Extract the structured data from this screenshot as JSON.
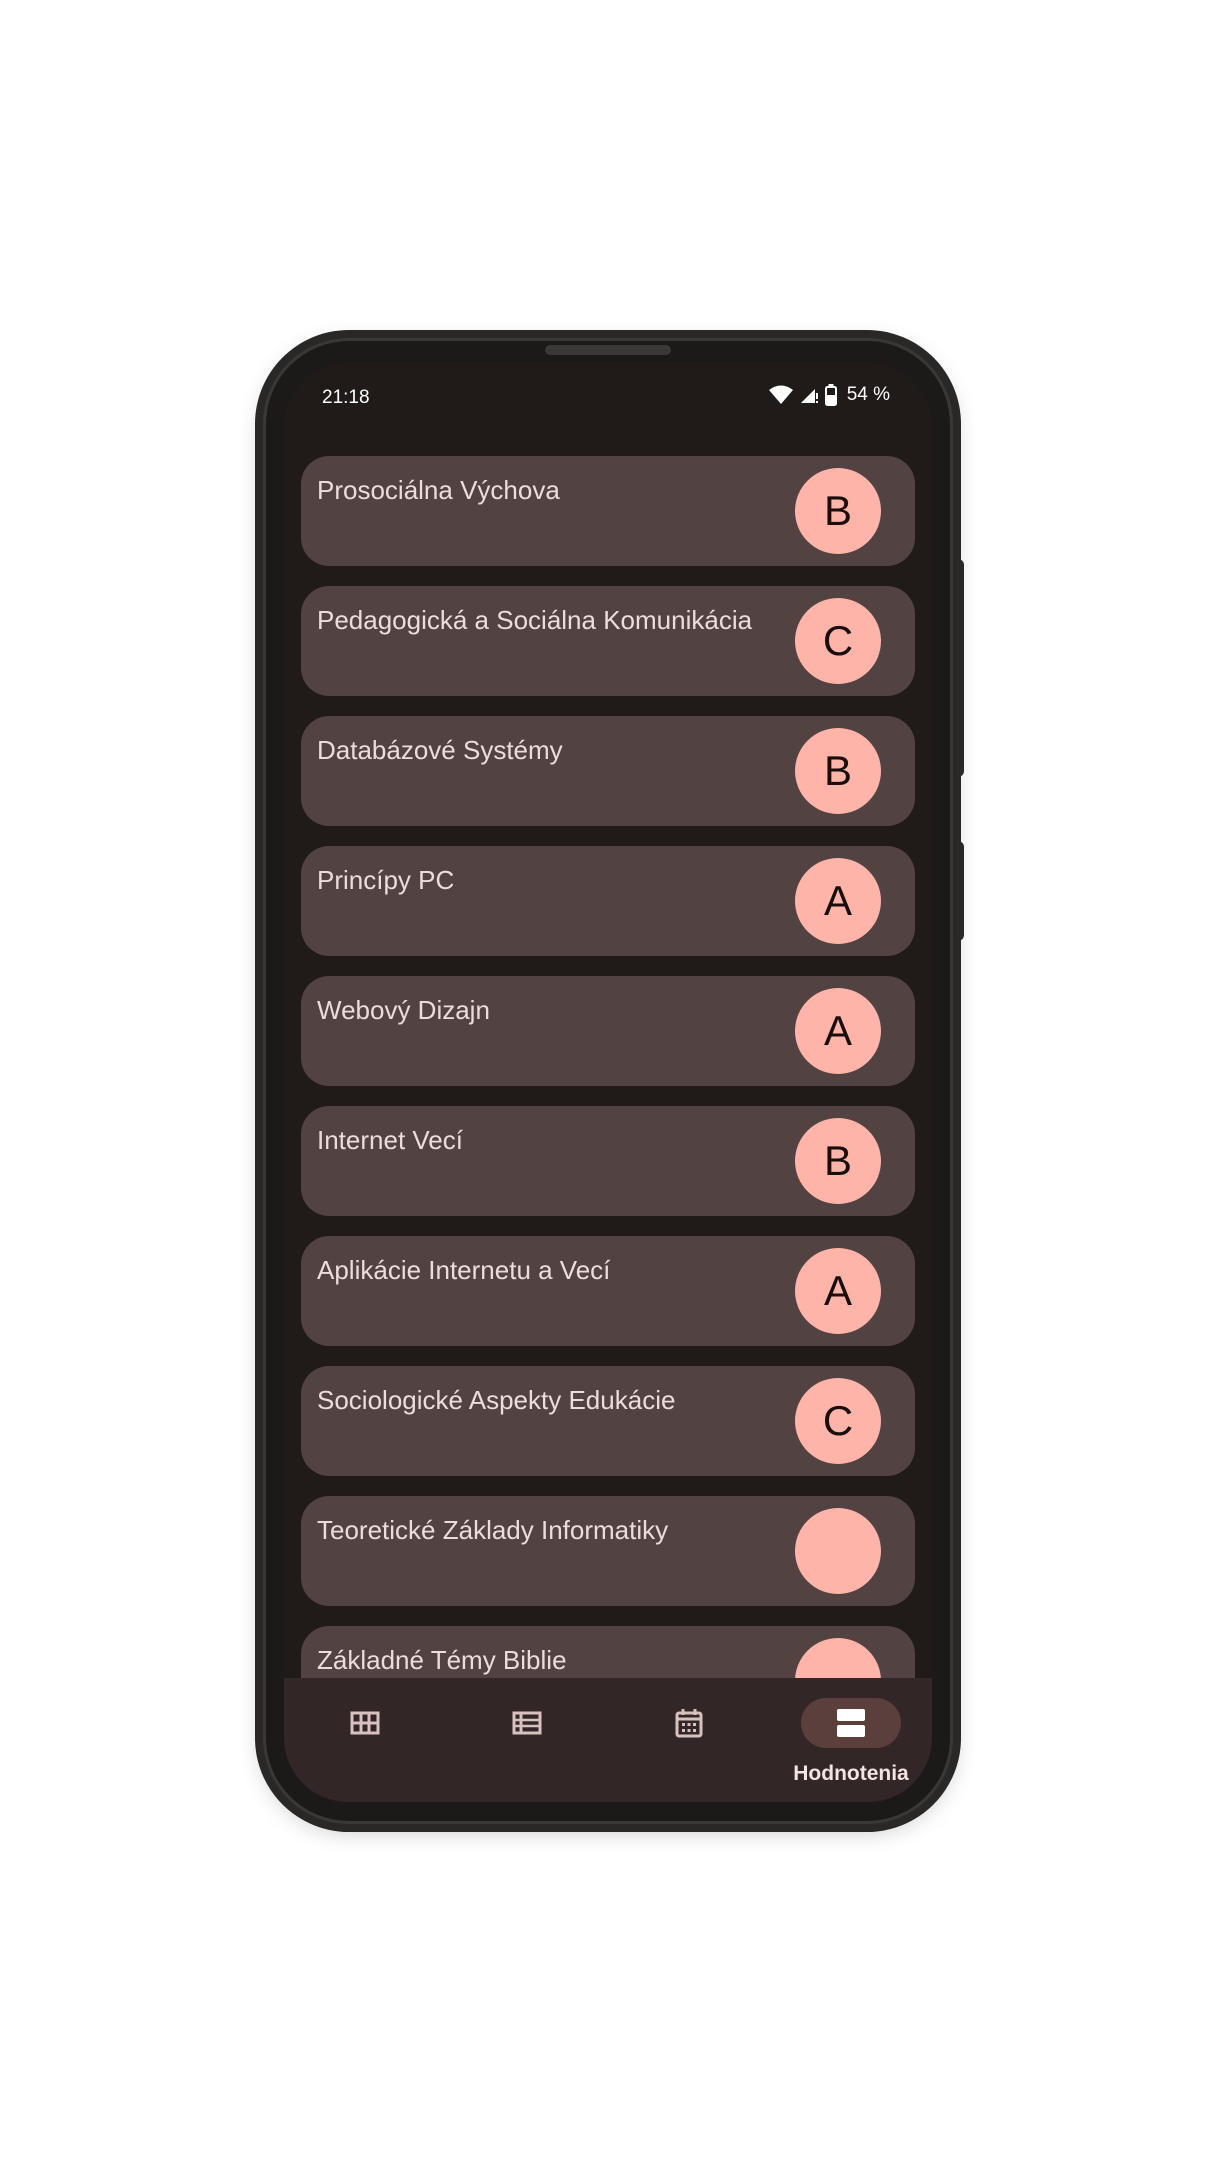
{
  "status_bar": {
    "time": "21:18",
    "battery": "54 %",
    "icons": [
      "wifi-icon",
      "cellular-signal-icon",
      "battery-icon"
    ]
  },
  "grades": [
    {
      "subject": "Prosociálna Výchova",
      "grade": "B"
    },
    {
      "subject": "Pedagogická a Sociálna Komunikácia",
      "grade": "C"
    },
    {
      "subject": "Databázové Systémy",
      "grade": "B"
    },
    {
      "subject": "Princípy PC",
      "grade": "A"
    },
    {
      "subject": "Webový Dizajn",
      "grade": "A"
    },
    {
      "subject": "Internet Vecí",
      "grade": "B"
    },
    {
      "subject": "Aplikácie Internetu a Vecí",
      "grade": "A"
    },
    {
      "subject": "Sociologické Aspekty Edukácie",
      "grade": "C"
    },
    {
      "subject": "Teoretické Základy Informatiky",
      "grade": ""
    },
    {
      "subject": "Základné Témy Biblie",
      "grade": ""
    }
  ],
  "bottom_nav": {
    "items": [
      {
        "icon": "grid-icon",
        "label": ""
      },
      {
        "icon": "list-icon",
        "label": ""
      },
      {
        "icon": "calendar-icon",
        "label": ""
      },
      {
        "icon": "grades-icon",
        "label": "Hodnotenia"
      }
    ],
    "active_index": 3
  },
  "colors": {
    "background": "#201a18",
    "card": "#534242",
    "grade_badge": "#ffb4aa",
    "nav_bar": "#322726",
    "nav_active_pill": "#5b3f3c"
  }
}
